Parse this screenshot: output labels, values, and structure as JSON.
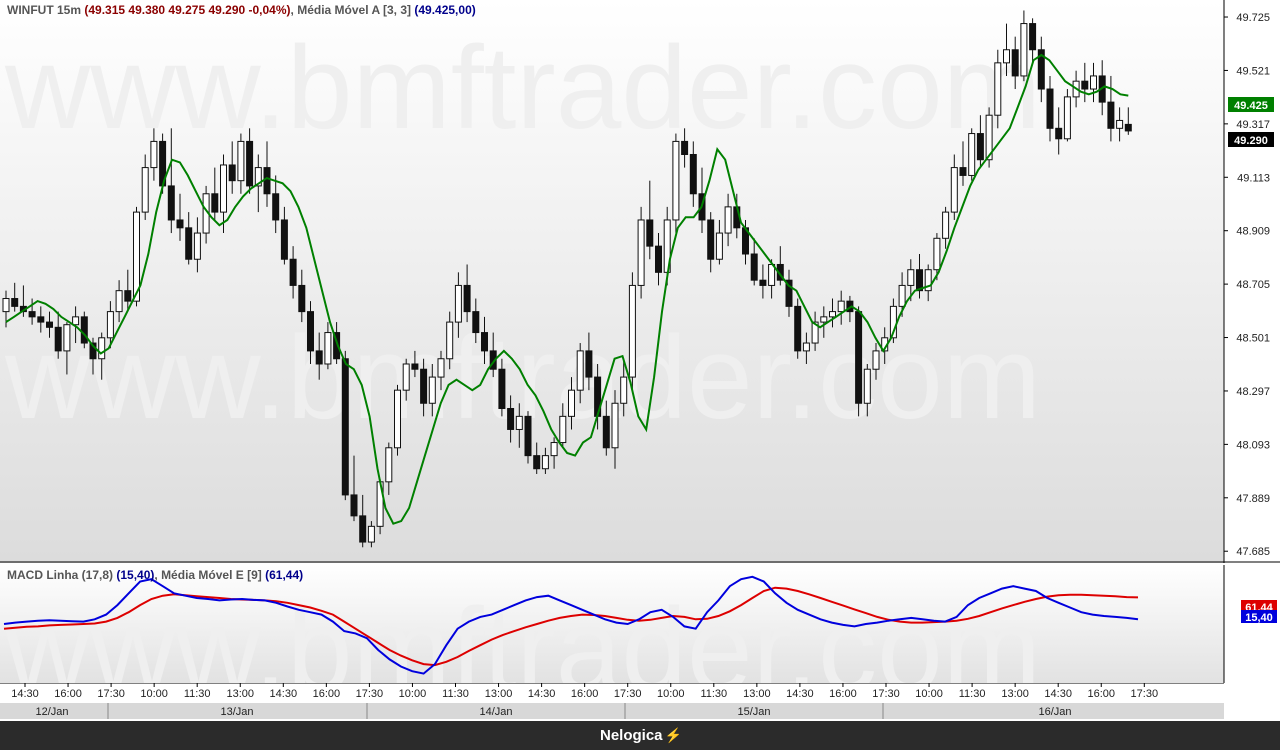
{
  "main_header": {
    "symbol": "WINFUT 15m",
    "ohlc": "(49.315  49.380  49.275  49.290  -0,04%)",
    "ma_label": "Média Móvel A [3, 3]",
    "ma_value": "(49.425,00)"
  },
  "macd_header": {
    "line_label": "MACD Linha (17,8)",
    "line_value": "(15,40)",
    "signal_label": "Média Móvel E [9]",
    "signal_value": "(61,44)"
  },
  "footer": {
    "brand": "Nelogica"
  },
  "watermark": "www.bmftrader.com",
  "colors": {
    "up": "#ffffff",
    "down": "#111111",
    "ma": "#008000",
    "macd": "#0000dd",
    "signal": "#dd0000",
    "ma_badge": "#008000",
    "last_badge": "#000000"
  },
  "chart_data": [
    {
      "type": "candlestick",
      "title": "WINFUT 15m",
      "ylim": [
        47640,
        49790
      ],
      "y_ticks": [
        "49.725",
        "49.521",
        "49.317",
        "49.113",
        "48.909",
        "48.705",
        "48.501",
        "48.297",
        "48.093",
        "47.889",
        "47.685"
      ],
      "last_price_label": "49.290",
      "ma_price_label": "49.425",
      "candles": [
        [
          48600,
          48680,
          48540,
          48650
        ],
        [
          48650,
          48710,
          48600,
          48620
        ],
        [
          48620,
          48700,
          48580,
          48600
        ],
        [
          48600,
          48650,
          48550,
          48580
        ],
        [
          48580,
          48620,
          48520,
          48560
        ],
        [
          48560,
          48600,
          48500,
          48540
        ],
        [
          48540,
          48600,
          48420,
          48450
        ],
        [
          48450,
          48560,
          48360,
          48550
        ],
        [
          48550,
          48620,
          48480,
          48580
        ],
        [
          48580,
          48600,
          48460,
          48480
        ],
        [
          48480,
          48500,
          48360,
          48420
        ],
        [
          48420,
          48520,
          48340,
          48500
        ],
        [
          48500,
          48640,
          48460,
          48600
        ],
        [
          48600,
          48720,
          48560,
          48680
        ],
        [
          48680,
          48760,
          48600,
          48640
        ],
        [
          48640,
          49000,
          48620,
          48980
        ],
        [
          48980,
          49200,
          48950,
          49150
        ],
        [
          49150,
          49300,
          49100,
          49250
        ],
        [
          49250,
          49280,
          49050,
          49080
        ],
        [
          49080,
          49300,
          48900,
          48950
        ],
        [
          48950,
          49050,
          48870,
          48920
        ],
        [
          48920,
          48980,
          48780,
          48800
        ],
        [
          48800,
          48960,
          48750,
          48900
        ],
        [
          48900,
          49080,
          48860,
          49050
        ],
        [
          49050,
          49150,
          48950,
          48980
        ],
        [
          48980,
          49200,
          48900,
          49160
        ],
        [
          49160,
          49250,
          49050,
          49100
        ],
        [
          49100,
          49280,
          49050,
          49250
        ],
        [
          49250,
          49300,
          49050,
          49080
        ],
        [
          49080,
          49200,
          48980,
          49150
        ],
        [
          49150,
          49250,
          49000,
          49050
        ],
        [
          49050,
          49120,
          48900,
          48950
        ],
        [
          48950,
          49000,
          48780,
          48800
        ],
        [
          48800,
          48850,
          48650,
          48700
        ],
        [
          48700,
          48760,
          48560,
          48600
        ],
        [
          48600,
          48640,
          48400,
          48450
        ],
        [
          48450,
          48520,
          48340,
          48400
        ],
        [
          48400,
          48560,
          48380,
          48520
        ],
        [
          48520,
          48560,
          48400,
          48420
        ],
        [
          48420,
          48450,
          47880,
          47900
        ],
        [
          47900,
          48050,
          47800,
          47820
        ],
        [
          47820,
          47900,
          47700,
          47720
        ],
        [
          47720,
          47800,
          47700,
          47780
        ],
        [
          47780,
          47960,
          47750,
          47950
        ],
        [
          47950,
          48100,
          47900,
          48080
        ],
        [
          48080,
          48320,
          48050,
          48300
        ],
        [
          48300,
          48420,
          48260,
          48400
        ],
        [
          48400,
          48450,
          48350,
          48380
        ],
        [
          48380,
          48420,
          48200,
          48250
        ],
        [
          48250,
          48400,
          48200,
          48350
        ],
        [
          48350,
          48450,
          48300,
          48420
        ],
        [
          48420,
          48600,
          48380,
          48560
        ],
        [
          48560,
          48750,
          48500,
          48700
        ],
        [
          48700,
          48780,
          48560,
          48600
        ],
        [
          48600,
          48650,
          48480,
          48520
        ],
        [
          48520,
          48580,
          48400,
          48450
        ],
        [
          48450,
          48520,
          48350,
          48380
        ],
        [
          48380,
          48420,
          48200,
          48230
        ],
        [
          48230,
          48280,
          48100,
          48150
        ],
        [
          48150,
          48250,
          48080,
          48200
        ],
        [
          48200,
          48220,
          48020,
          48050
        ],
        [
          48050,
          48100,
          47980,
          48000
        ],
        [
          48000,
          48080,
          47980,
          48050
        ],
        [
          48050,
          48120,
          48000,
          48100
        ],
        [
          48100,
          48250,
          48080,
          48200
        ],
        [
          48200,
          48350,
          48150,
          48300
        ],
        [
          48300,
          48480,
          48250,
          48450
        ],
        [
          48450,
          48520,
          48300,
          48350
        ],
        [
          48350,
          48400,
          48150,
          48200
        ],
        [
          48200,
          48260,
          48050,
          48080
        ],
        [
          48080,
          48300,
          48000,
          48250
        ],
        [
          48250,
          48420,
          48200,
          48350
        ],
        [
          48350,
          48750,
          48300,
          48700
        ],
        [
          48700,
          49000,
          48650,
          48950
        ],
        [
          48950,
          49100,
          48800,
          48850
        ],
        [
          48850,
          48900,
          48700,
          48750
        ],
        [
          48750,
          49000,
          48700,
          48950
        ],
        [
          48950,
          49280,
          48900,
          49250
        ],
        [
          49250,
          49300,
          49150,
          49200
        ],
        [
          49200,
          49250,
          49000,
          49050
        ],
        [
          49050,
          49150,
          48900,
          48950
        ],
        [
          48950,
          48980,
          48750,
          48800
        ],
        [
          48800,
          48950,
          48780,
          48900
        ],
        [
          48900,
          49050,
          48850,
          49000
        ],
        [
          49000,
          49050,
          48880,
          48920
        ],
        [
          48920,
          48950,
          48780,
          48820
        ],
        [
          48820,
          48880,
          48700,
          48720
        ],
        [
          48720,
          48780,
          48650,
          48700
        ],
        [
          48700,
          48800,
          48650,
          48780
        ],
        [
          48780,
          48850,
          48700,
          48720
        ],
        [
          48720,
          48760,
          48580,
          48620
        ],
        [
          48620,
          48650,
          48420,
          48450
        ],
        [
          48450,
          48520,
          48400,
          48480
        ],
        [
          48480,
          48600,
          48450,
          48560
        ],
        [
          48560,
          48620,
          48500,
          48580
        ],
        [
          48580,
          48650,
          48540,
          48600
        ],
        [
          48600,
          48680,
          48550,
          48640
        ],
        [
          48640,
          48660,
          48560,
          48600
        ],
        [
          48600,
          48620,
          48200,
          48250
        ],
        [
          48250,
          48400,
          48200,
          48380
        ],
        [
          48380,
          48480,
          48340,
          48450
        ],
        [
          48450,
          48540,
          48400,
          48500
        ],
        [
          48500,
          48650,
          48480,
          48620
        ],
        [
          48620,
          48750,
          48580,
          48700
        ],
        [
          48700,
          48800,
          48640,
          48760
        ],
        [
          48760,
          48820,
          48650,
          48680
        ],
        [
          48680,
          48780,
          48640,
          48760
        ],
        [
          48760,
          48900,
          48720,
          48880
        ],
        [
          48880,
          49000,
          48840,
          48980
        ],
        [
          48980,
          49200,
          48950,
          49150
        ],
        [
          49150,
          49250,
          49080,
          49120
        ],
        [
          49120,
          49300,
          49100,
          49280
        ],
        [
          49280,
          49350,
          49150,
          49180
        ],
        [
          49180,
          49380,
          49150,
          49350
        ],
        [
          49350,
          49600,
          49300,
          49550
        ],
        [
          49550,
          49700,
          49500,
          49600
        ],
        [
          49600,
          49650,
          49450,
          49500
        ],
        [
          49500,
          49750,
          49480,
          49700
        ],
        [
          49700,
          49720,
          49550,
          49600
        ],
        [
          49600,
          49650,
          49400,
          49450
        ],
        [
          49450,
          49500,
          49250,
          49300
        ],
        [
          49300,
          49380,
          49200,
          49260
        ],
        [
          49260,
          49450,
          49250,
          49420
        ],
        [
          49420,
          49520,
          49380,
          49480
        ],
        [
          49480,
          49550,
          49400,
          49450
        ],
        [
          49450,
          49550,
          49400,
          49500
        ],
        [
          49500,
          49560,
          49350,
          49400
        ],
        [
          49400,
          49500,
          49250,
          49300
        ],
        [
          49300,
          49380,
          49250,
          49330
        ],
        [
          49315,
          49380,
          49275,
          49290
        ]
      ],
      "ma": [
        48560,
        48580,
        48600,
        48620,
        48640,
        48630,
        48610,
        48580,
        48560,
        48540,
        48510,
        48470,
        48440,
        48460,
        48520,
        48580,
        48640,
        48700,
        48820,
        48980,
        49100,
        49180,
        49170,
        49120,
        49060,
        49000,
        48960,
        48930,
        48950,
        49000,
        49040,
        49070,
        49090,
        49110,
        49100,
        49090,
        49060,
        49000,
        48920,
        48800,
        48680,
        48560,
        48470,
        48400,
        48380,
        48320,
        48200,
        48000,
        47850,
        47790,
        47800,
        47850,
        47950,
        48050,
        48150,
        48250,
        48320,
        48340,
        48320,
        48300,
        48320,
        48380,
        48420,
        48450,
        48420,
        48380,
        48320,
        48280,
        48220,
        48150,
        48100,
        48060,
        48050,
        48100,
        48120,
        48220,
        48320,
        48420,
        48430,
        48330,
        48200,
        48150,
        48350,
        48600,
        48800,
        48920,
        48960,
        48960,
        49000,
        49100,
        49220,
        49180,
        49060,
        48940,
        48900,
        48860,
        48820,
        48780,
        48740,
        48700,
        48680,
        48620,
        48560,
        48540,
        48560,
        48580,
        48600,
        48620,
        48600,
        48560,
        48500,
        48450,
        48500,
        48580,
        48640,
        48680,
        48690,
        48700,
        48750,
        48830,
        48920,
        49000,
        49080,
        49140,
        49180,
        49220,
        49260,
        49300,
        49380,
        49460,
        49560,
        49580,
        49560,
        49520,
        49480,
        49460,
        49440,
        49430,
        49440,
        49460,
        49450,
        49430,
        49425
      ]
    },
    {
      "type": "line",
      "title": "MACD Linha (17,8)",
      "ylim": [
        -120,
        130
      ],
      "series": [
        {
          "name": "MACD Linha (17,8)",
          "values": [
            5,
            8,
            10,
            12,
            13,
            12,
            11,
            10,
            15,
            25,
            45,
            70,
            95,
            100,
            85,
            70,
            65,
            60,
            58,
            55,
            57,
            58,
            56,
            55,
            50,
            42,
            35,
            30,
            25,
            10,
            -10,
            -15,
            -25,
            -50,
            -70,
            -85,
            -95,
            -100,
            -80,
            -40,
            -5,
            10,
            20,
            25,
            35,
            45,
            55,
            62,
            65,
            55,
            45,
            35,
            25,
            15,
            8,
            5,
            15,
            30,
            35,
            20,
            0,
            -5,
            30,
            55,
            85,
            100,
            105,
            95,
            70,
            50,
            35,
            25,
            15,
            8,
            3,
            0,
            5,
            8,
            12,
            15,
            18,
            15,
            12,
            10,
            20,
            45,
            60,
            70,
            80,
            85,
            80,
            75,
            60,
            50,
            40,
            30,
            25,
            22,
            20,
            18,
            15
          ]
        },
        {
          "name": "Média Móvel E [9]",
          "values": [
            -5,
            -3,
            -1,
            0,
            2,
            3,
            4,
            5,
            6,
            10,
            18,
            30,
            45,
            58,
            65,
            68,
            66,
            64,
            62,
            60,
            58,
            57,
            56,
            55,
            53,
            50,
            45,
            40,
            33,
            25,
            10,
            -5,
            -20,
            -35,
            -50,
            -62,
            -72,
            -80,
            -82,
            -75,
            -65,
            -52,
            -40,
            -28,
            -18,
            -10,
            -2,
            5,
            12,
            18,
            22,
            25,
            24,
            22,
            18,
            14,
            12,
            14,
            18,
            22,
            20,
            15,
            16,
            22,
            32,
            45,
            60,
            75,
            82,
            80,
            75,
            68,
            60,
            52,
            44,
            36,
            28,
            20,
            14,
            10,
            8,
            8,
            9,
            10,
            12,
            16,
            22,
            30,
            38,
            45,
            52,
            58,
            63,
            66,
            67,
            67,
            66,
            65,
            64,
            62,
            61.44
          ]
        }
      ],
      "macd_badge": "15,40",
      "signal_badge": "61,44"
    }
  ],
  "time_axis": {
    "ticks": [
      "14:30",
      "16:00",
      "17:30",
      "10:00",
      "11:30",
      "13:00",
      "14:30",
      "16:00",
      "17:30",
      "10:00",
      "11:30",
      "13:00",
      "14:30",
      "16:00",
      "17:30",
      "10:00",
      "11:30",
      "13:00",
      "14:30",
      "16:00",
      "17:30",
      "10:00",
      "11:30",
      "13:00",
      "14:30",
      "16:00",
      "17:30"
    ],
    "days": [
      "12/Jan",
      "13/Jan",
      "14/Jan",
      "15/Jan",
      "16/Jan"
    ]
  }
}
